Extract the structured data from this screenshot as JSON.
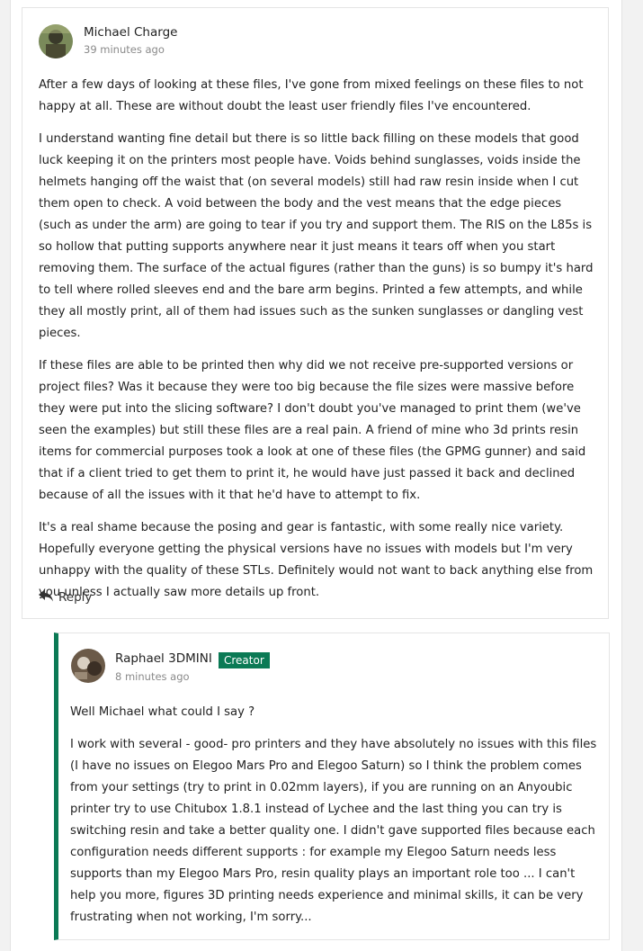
{
  "comment": {
    "author": "Michael Charge",
    "time": "39 minutes ago",
    "paragraphs": [
      "After a few days of looking at these files, I've gone from mixed feelings on these files to not happy at all. These are without doubt the least user friendly files I've encountered.",
      "I understand wanting fine detail but there is so little back filling on these models that good luck keeping it on the printers most people have. Voids behind sunglasses, voids inside the helmets hanging off the waist that (on several models) still had raw resin inside when I cut them open to check. A void between the body and the vest means that the edge pieces (such as under the arm) are going to tear if you try and support them. The RIS on the L85s is so hollow that putting supports anywhere near it just means it tears off when you start removing them. The surface of the actual figures (rather than the guns) is so bumpy it's hard to tell where rolled sleeves end and the bare arm begins. Printed a few attempts, and while they all mostly print, all of them had issues such as the sunken sunglasses or dangling vest pieces.",
      "If these files are able to be printed then why did we not receive pre-supported versions or project files? Was it because they were too big because the file sizes were massive before they were put into the slicing software? I don't doubt you've managed to print them (we've seen the examples) but still these files are a real pain. A friend of mine who 3d prints resin items for commercial purposes took a look at one of these files (the GPMG gunner) and said that if a client tried to get them to print it, he would have just passed it back and declined because of all the issues with it that he'd have to attempt to fix.",
      "It's a real shame because the posing and gear is fantastic, with some really nice variety. Hopefully everyone getting the physical versions have no issues with models but I'm very unhappy with the quality of these STLs. Definitely would not want to back anything else from you unless I actually saw more details up front."
    ],
    "reply_label": "Reply"
  },
  "reply": {
    "author": "Raphael 3DMINI",
    "badge": "Creator",
    "time": "8 minutes ago",
    "paragraphs": [
      "Well Michael what could I say ?",
      "I work with several - good- pro printers and they have absolutely no issues with this files (I have no issues on Elegoo Mars Pro and Elegoo Saturn) so I think the problem comes from your settings (try to print in 0.02mm layers), if you are running on an Anyoubic printer try to use Chitubox 1.8.1 instead of Lychee and the last thing you can try is switching resin and take a better quality one. I didn't gave supported files because each configuration needs different supports : for example my Elegoo Saturn needs less supports than my Elegoo Mars Pro, resin quality plays an important role too ... I can't help you more, figures 3D printing needs experience and minimal skills, it can be very frustrating when not working, I'm sorry..."
    ]
  },
  "colors": {
    "accent": "#0b7a55",
    "muted_text": "#8a8a8a"
  }
}
